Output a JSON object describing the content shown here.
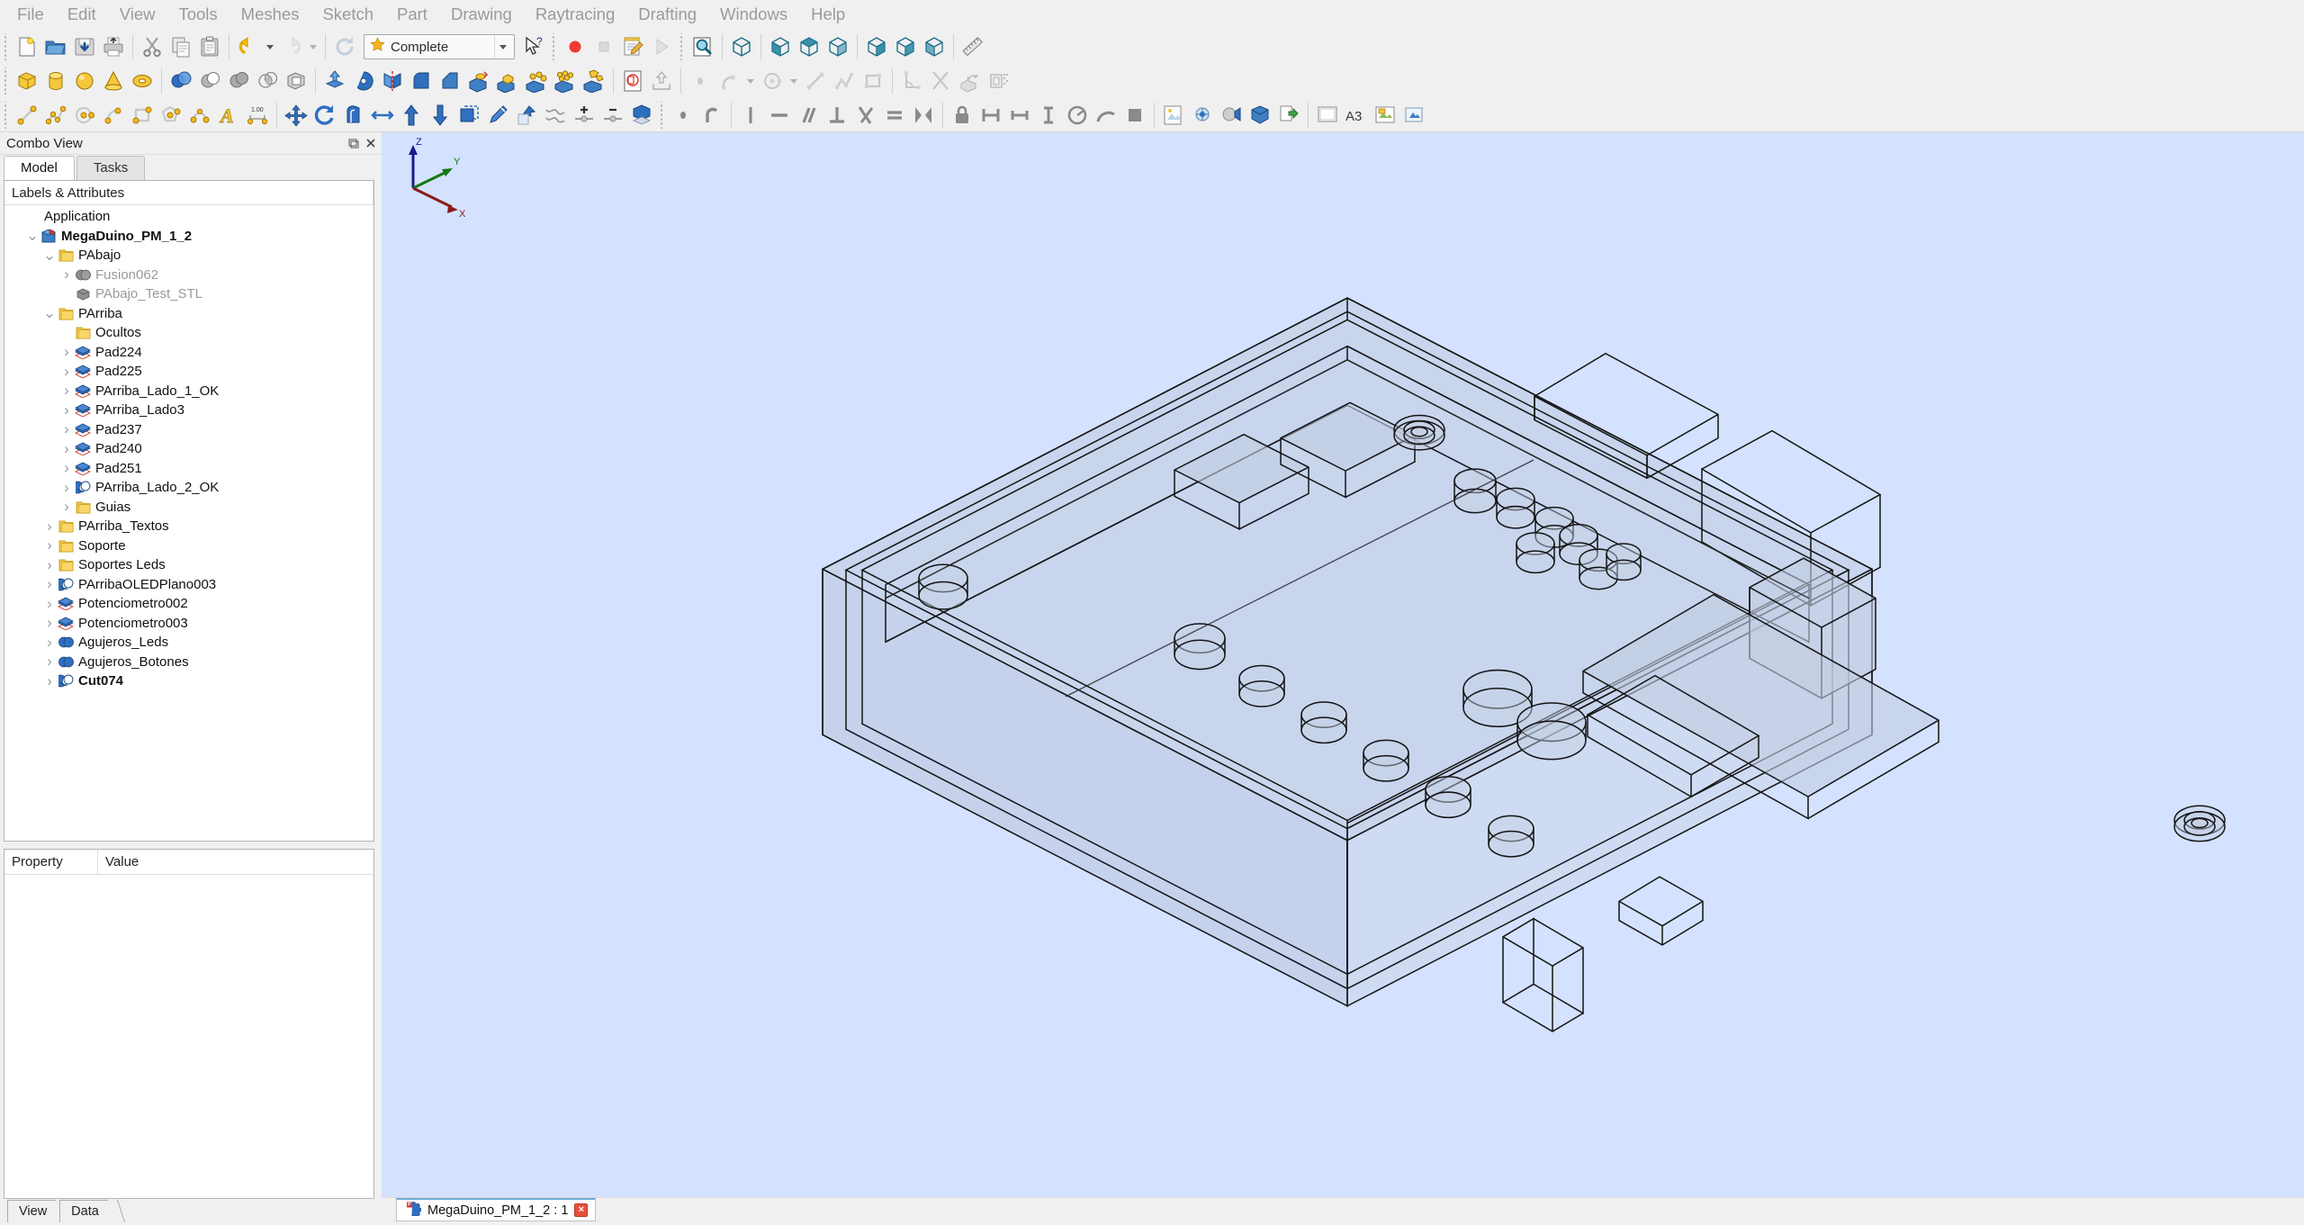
{
  "app": {
    "title": "FreeCAD",
    "menu": [
      "File",
      "Edit",
      "View",
      "Tools",
      "Meshes",
      "Sketch",
      "Part",
      "Drawing",
      "Raytracing",
      "Drafting",
      "Windows",
      "Help"
    ]
  },
  "toolbars": {
    "file": [
      {
        "name": "new-document-button",
        "title": "New"
      },
      {
        "name": "open-document-button",
        "title": "Open"
      },
      {
        "name": "save-document-button",
        "title": "Save"
      },
      {
        "name": "print-document-button",
        "title": "Print"
      },
      {
        "name": "cut-button",
        "title": "Cut"
      },
      {
        "name": "copy-button",
        "title": "Copy"
      },
      {
        "name": "paste-button",
        "title": "Paste"
      },
      {
        "name": "undo-button",
        "title": "Undo"
      },
      {
        "name": "redo-button",
        "title": "Redo"
      },
      {
        "name": "refresh-button",
        "title": "Refresh"
      }
    ],
    "workbench": {
      "label": "Complete",
      "name": "workbench-selector"
    },
    "whats_this": {
      "name": "whats-this-button",
      "title": "What's This"
    },
    "macro": [
      {
        "name": "macro-record-button",
        "title": "Macro recording"
      },
      {
        "name": "macro-stop-button",
        "title": "Stop macro recording"
      },
      {
        "name": "macro-edit-button",
        "title": "Macros"
      },
      {
        "name": "macro-execute-button",
        "title": "Execute macro"
      }
    ],
    "view": [
      {
        "name": "fit-all-button",
        "title": "Fit all"
      },
      {
        "name": "axonometric-view-button",
        "title": "Axonometric"
      },
      {
        "name": "front-view-button",
        "title": "Front"
      },
      {
        "name": "top-view-button",
        "title": "Top"
      },
      {
        "name": "right-view-button",
        "title": "Right"
      },
      {
        "name": "rear-view-button",
        "title": "Rear"
      },
      {
        "name": "bottom-view-button",
        "title": "Bottom"
      },
      {
        "name": "left-view-button",
        "title": "Left"
      },
      {
        "name": "measure-button",
        "title": "Measure"
      }
    ],
    "primitives": [
      {
        "name": "box-primitive-button",
        "title": "Box"
      },
      {
        "name": "cylinder-primitive-button",
        "title": "Cylinder"
      },
      {
        "name": "sphere-primitive-button",
        "title": "Sphere"
      },
      {
        "name": "cone-primitive-button",
        "title": "Cone"
      },
      {
        "name": "torus-primitive-button",
        "title": "Torus"
      }
    ],
    "boolean": [
      {
        "name": "boolean-button",
        "title": "Boolean"
      },
      {
        "name": "cut-shape-button",
        "title": "Cut"
      },
      {
        "name": "union-shape-button",
        "title": "Union"
      },
      {
        "name": "common-shape-button",
        "title": "Intersection"
      },
      {
        "name": "section-shape-button",
        "title": "Section"
      }
    ],
    "part": [
      {
        "name": "extrude-button",
        "title": "Extrude"
      },
      {
        "name": "revolve-button",
        "title": "Revolve"
      },
      {
        "name": "mirror-button",
        "title": "Mirror"
      },
      {
        "name": "fillet-button",
        "title": "Fillet"
      },
      {
        "name": "chamfer-button",
        "title": "Chamfer"
      },
      {
        "name": "thickness-button",
        "title": "Thickness"
      },
      {
        "name": "offset-shape-button",
        "title": "3D Offset"
      },
      {
        "name": "ruled-surface-button",
        "title": "Ruled surface"
      },
      {
        "name": "loft-button",
        "title": "Loft"
      },
      {
        "name": "sweep-button",
        "title": "Sweep"
      },
      {
        "name": "cross-sections-button",
        "title": "Cross-sections"
      },
      {
        "name": "compound-button",
        "title": "Compound"
      },
      {
        "name": "explode-compound-button",
        "title": "Explode compound"
      },
      {
        "name": "import-shape-button",
        "title": "Import shape"
      },
      {
        "name": "export-shape-button",
        "title": "Export shape"
      }
    ],
    "sketch": [
      {
        "name": "sketch-point-button",
        "title": "Point"
      },
      {
        "name": "sketch-arc-button",
        "title": "Arc"
      },
      {
        "name": "sketch-circle-button",
        "title": "Circle"
      },
      {
        "name": "sketch-line-button",
        "title": "Line"
      },
      {
        "name": "sketch-polyline-button",
        "title": "Polyline"
      },
      {
        "name": "sketch-rectangle-button",
        "title": "Rectangle"
      },
      {
        "name": "sketch-external-button",
        "title": "External geometry"
      },
      {
        "name": "sketch-trim-button",
        "title": "Trim edge"
      },
      {
        "name": "sketch-view-section-button",
        "title": "View section"
      },
      {
        "name": "sketch-grid-button",
        "title": "Toggle grid"
      }
    ],
    "draft": [
      {
        "name": "draft-line-button",
        "title": "Line"
      },
      {
        "name": "draft-wire-button",
        "title": "Polyline"
      },
      {
        "name": "draft-circle-button",
        "title": "Circle"
      },
      {
        "name": "draft-arc-button",
        "title": "Arc"
      },
      {
        "name": "draft-rectangle-button",
        "title": "Rectangle"
      },
      {
        "name": "draft-polygon-button",
        "title": "Polygon"
      },
      {
        "name": "draft-bspline-button",
        "title": "BSpline"
      },
      {
        "name": "draft-text-button",
        "title": "Text"
      },
      {
        "name": "draft-dimension-button",
        "title": "Dimension"
      },
      {
        "name": "draft-move-button",
        "title": "Move"
      },
      {
        "name": "draft-rotate-button",
        "title": "Rotate"
      },
      {
        "name": "draft-offset-button",
        "title": "Offset"
      },
      {
        "name": "draft-trimex-button",
        "title": "Trimex"
      },
      {
        "name": "draft-upgrade-button",
        "title": "Upgrade"
      },
      {
        "name": "draft-downgrade-button",
        "title": "Downgrade"
      },
      {
        "name": "draft-scale-button",
        "title": "Scale"
      },
      {
        "name": "draft-edit-button",
        "title": "Edit"
      },
      {
        "name": "draft-wire-to-bspline-button",
        "title": "Wire to BSpline"
      },
      {
        "name": "draft-add-point-button",
        "title": "Add point"
      },
      {
        "name": "draft-remove-point-button",
        "title": "Remove point"
      },
      {
        "name": "draft-shape2dview-button",
        "title": "Shape 2D view"
      }
    ],
    "constraints": [
      {
        "name": "constraint-point-button",
        "title": "Coincident"
      },
      {
        "name": "constraint-tangent-button",
        "title": "Tangent"
      },
      {
        "name": "constraint-vertical-button",
        "title": "Vertical"
      },
      {
        "name": "constraint-horizontal-button",
        "title": "Horizontal"
      },
      {
        "name": "constraint-parallel-button",
        "title": "Parallel"
      },
      {
        "name": "constraint-perpendicular-button",
        "title": "Perpendicular"
      },
      {
        "name": "constraint-angle-button",
        "title": "Angle"
      },
      {
        "name": "constraint-equal-button",
        "title": "Equal"
      },
      {
        "name": "constraint-symmetric-button",
        "title": "Symmetric"
      },
      {
        "name": "constraint-lock-button",
        "title": "Lock"
      },
      {
        "name": "constraint-distance-button",
        "title": "Distance"
      },
      {
        "name": "constraint-distance-x-button",
        "title": "Horizontal distance"
      },
      {
        "name": "constraint-distance-y-button",
        "title": "Vertical distance"
      },
      {
        "name": "constraint-radius-button",
        "title": "Radius"
      },
      {
        "name": "constraint-arc-button",
        "title": "Arc length"
      },
      {
        "name": "constraint-block-button",
        "title": "Block"
      }
    ],
    "misc": [
      {
        "name": "drawing-page-button",
        "title": "New drawing page"
      },
      {
        "name": "drawing-view-button",
        "title": "Insert view"
      },
      {
        "name": "mesh-analyze-button",
        "title": "Analyze mesh"
      },
      {
        "name": "mesh-boolean-button",
        "title": "Mesh boolean"
      },
      {
        "name": "raytracing-project-button",
        "title": "New raytracing project"
      },
      {
        "name": "raytracing-render-button",
        "title": "Render"
      },
      {
        "name": "page-a3-button",
        "title": "A3"
      },
      {
        "name": "drawing-annotation-button",
        "title": "Annotation"
      },
      {
        "name": "drawing-export-button",
        "title": "Export page"
      }
    ]
  },
  "combo_view": {
    "title": "Combo View",
    "float_button": "float-panel-button",
    "close_button": "close-panel-button",
    "tabs": [
      {
        "label": "Model",
        "active": true
      },
      {
        "label": "Tasks",
        "active": false
      }
    ],
    "tree_header": "Labels & Attributes",
    "tree": [
      {
        "label": "Application",
        "depth": 0,
        "icon": "none",
        "arrow": "none",
        "style": "plain"
      },
      {
        "label": "MegaDuino_PM_1_2",
        "depth": 1,
        "icon": "document",
        "arrow": "open",
        "style": "bold"
      },
      {
        "label": "PAbajo",
        "depth": 2,
        "icon": "folder",
        "arrow": "open",
        "style": "plain"
      },
      {
        "label": "Fusion062",
        "depth": 3,
        "icon": "fusion-gray",
        "arrow": "closed",
        "style": "hidden"
      },
      {
        "label": "PAbajo_Test_STL",
        "depth": 3,
        "icon": "mesh-gray",
        "arrow": "none",
        "style": "hidden"
      },
      {
        "label": "PArriba",
        "depth": 2,
        "icon": "folder",
        "arrow": "open",
        "style": "plain"
      },
      {
        "label": "Ocultos",
        "depth": 3,
        "icon": "folder",
        "arrow": "none",
        "style": "plain"
      },
      {
        "label": "Pad224",
        "depth": 3,
        "icon": "pad",
        "arrow": "closed",
        "style": "plain"
      },
      {
        "label": "Pad225",
        "depth": 3,
        "icon": "pad",
        "arrow": "closed",
        "style": "plain"
      },
      {
        "label": "PArriba_Lado_1_OK",
        "depth": 3,
        "icon": "pad",
        "arrow": "closed",
        "style": "plain"
      },
      {
        "label": "PArriba_Lado3",
        "depth": 3,
        "icon": "pad",
        "arrow": "closed",
        "style": "plain"
      },
      {
        "label": "Pad237",
        "depth": 3,
        "icon": "pad",
        "arrow": "closed",
        "style": "plain"
      },
      {
        "label": "Pad240",
        "depth": 3,
        "icon": "pad",
        "arrow": "closed",
        "style": "plain"
      },
      {
        "label": "Pad251",
        "depth": 3,
        "icon": "pad",
        "arrow": "closed",
        "style": "plain"
      },
      {
        "label": "PArriba_Lado_2_OK",
        "depth": 3,
        "icon": "cut",
        "arrow": "closed",
        "style": "plain"
      },
      {
        "label": "Guias",
        "depth": 3,
        "icon": "folder",
        "arrow": "closed",
        "style": "plain"
      },
      {
        "label": "PArriba_Textos",
        "depth": 2,
        "icon": "folder",
        "arrow": "closed",
        "style": "plain"
      },
      {
        "label": "Soporte",
        "depth": 2,
        "icon": "folder",
        "arrow": "closed",
        "style": "plain"
      },
      {
        "label": "Soportes Leds",
        "depth": 2,
        "icon": "folder",
        "arrow": "closed",
        "style": "plain"
      },
      {
        "label": "PArribaOLEDPlano003",
        "depth": 2,
        "icon": "cut",
        "arrow": "closed",
        "style": "plain"
      },
      {
        "label": "Potenciometro002",
        "depth": 2,
        "icon": "pad",
        "arrow": "closed",
        "style": "plain"
      },
      {
        "label": "Potenciometro003",
        "depth": 2,
        "icon": "pad",
        "arrow": "closed",
        "style": "plain"
      },
      {
        "label": "Agujeros_Leds",
        "depth": 2,
        "icon": "fusion",
        "arrow": "closed",
        "style": "plain"
      },
      {
        "label": "Agujeros_Botones",
        "depth": 2,
        "icon": "fusion",
        "arrow": "closed",
        "style": "plain"
      },
      {
        "label": "Cut074",
        "depth": 2,
        "icon": "cut",
        "arrow": "closed",
        "style": "bold"
      }
    ],
    "property_editor": {
      "columns": [
        "Property",
        "Value"
      ],
      "rows": []
    },
    "bottom_tabs": [
      {
        "label": "View"
      },
      {
        "label": "Data"
      }
    ]
  },
  "mdi": {
    "tabs": [
      {
        "label": "MegaDuino_PM_1_2 : 1",
        "active": true,
        "close": "×"
      }
    ]
  },
  "viewport": {
    "background_color": "#d4e2ff",
    "face_color": "#c2cde2",
    "edge_color": "#1c1c1c",
    "axis_cross": {
      "x_label": "X",
      "y_label": "Y",
      "z_label": "Z",
      "x_color": "#8b1a1a",
      "y_color": "#137a13",
      "z_color": "#1a1a8b"
    }
  },
  "colors": {
    "chrome": "#f0f0f0",
    "accent": "#6fa8dc",
    "folder": "#f3ca4b",
    "pad_icon": "#2f6fc0",
    "close_red": "#e8503a"
  }
}
